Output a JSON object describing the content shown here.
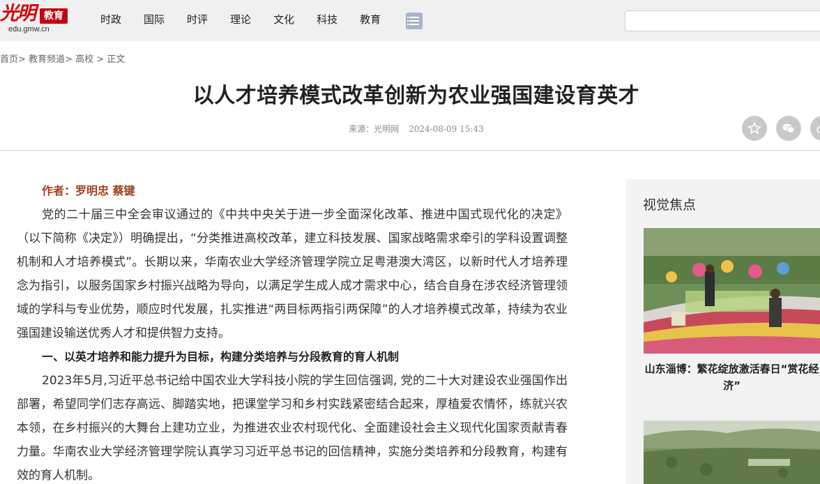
{
  "header": {
    "logo_script": "光明",
    "logo_badge": "教育",
    "logo_url": "edu.gmw.cn",
    "nav": [
      "时政",
      "国际",
      "时评",
      "理论",
      "文化",
      "科技",
      "教育"
    ],
    "menu_icon": "list-icon",
    "search_value": ""
  },
  "breadcrumb": {
    "home": "首页",
    "channel": "教育频道",
    "section": "高校",
    "current": "正文",
    "sep1": ">",
    "sep2": ">",
    "sep3": ">"
  },
  "article": {
    "title": "以人才培养模式改革创新为农业强国建设育英才",
    "source_label": "来源：",
    "source": "光明网",
    "date": "2024-08-09 15:43",
    "author": "作者：罗明忠 蔡键",
    "paragraphs": [
      "党的二十届三中全会审议通过的《中共中央关于进一步全面深化改革、推进中国式现代化的决定》（以下简称《决定》）明确提出，“分类推进高校改革，建立科技发展、国家战略需求牵引的学科设置调整机制和人才培养模式”。长期以来，华南农业大学经济管理学院立足粤港澳大湾区，以新时代人才培养理念为指引，以服务国家乡村振兴战略为导向，以满足学生成人成才需求中心，结合自身在涉农经济管理领域的学科与专业优势，顺应时代发展，扎实推进“两目标两指引两保障”的人才培养模式改革，持续为农业强国建设输送优秀人才和提供智力支持。",
      "2023年5月,习近平总书记给中国农业大学科技小院的学生回信强调, 党的二十大对建设农业强国作出部署，希望同学们志存高远、脚踏实地，把课堂学习和乡村实践紧密结合起来，厚植爱农情怀，练就兴农本领，在乡村振兴的大舞台上建功立业，为推进农业农村现代化、全面建设社会主义现代化国家贡献青春力量。华南农业大学经济管理学院认真学习习近平总书记的回信精神，实施分类培养和分段教育，构建有效的育人机制。"
    ],
    "subheading": "一、以英才培养和能力提升为目标，构建分类培养与分段教育的育人机制"
  },
  "share": {
    "icons": [
      "star-icon",
      "wechat-icon",
      "weibo-icon"
    ]
  },
  "sidebar": {
    "title": "视觉焦点",
    "item1_caption": "山东淄博：繁花绽放激活春日“赏花经济”"
  },
  "colors": {
    "brand_red": "#d7000f",
    "author_color": "#a0421a",
    "header_bg": "#f0f0f0",
    "sidebar_bg": "#f3f3f3"
  }
}
